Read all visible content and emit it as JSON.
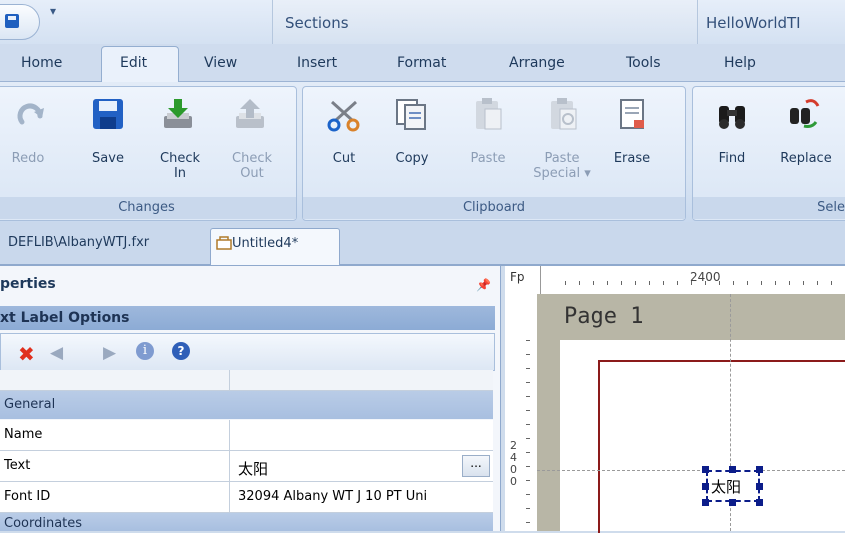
{
  "window": {
    "context_tab_group": "Sections",
    "app_title": "HelloWorldTI"
  },
  "tabs": [
    "Home",
    "Edit",
    "View",
    "Insert",
    "Format",
    "Arrange",
    "Tools",
    "Help"
  ],
  "ribbon": {
    "groups": {
      "changes": "Changes",
      "clipboard": "Clipboard",
      "select": "Sele"
    },
    "buttons": {
      "redo": "Redo",
      "save": "Save",
      "check_in_1": "Check",
      "check_in_2": "In",
      "check_out_1": "Check",
      "check_out_2": "Out",
      "cut": "Cut",
      "copy": "Copy",
      "paste": "Paste",
      "paste_special_1": "Paste",
      "paste_special_2": "Special ▾",
      "erase": "Erase",
      "find": "Find",
      "replace": "Replace"
    }
  },
  "doc_tabs": {
    "tab1": "DEFLIB\\AlbanyWTJ.fxr",
    "tab2": "Untitled4*"
  },
  "properties": {
    "panel_title": "perties",
    "section_title": "xt Label Options",
    "categories": {
      "general": "General",
      "coordinates": "Coordinates"
    },
    "rows": [
      {
        "name": "Name",
        "value": ""
      },
      {
        "name": "Text",
        "value": "太阳"
      },
      {
        "name": "Font ID",
        "value": "32094 Albany WT J 10 PT Uni"
      }
    ],
    "ellipsis": "..."
  },
  "canvas": {
    "ruler_corner": "Fp",
    "ruler_mark": "2400",
    "page_label": "Page 1",
    "ruler_left_digits": "2\n4\n0\n0",
    "label_text": "太阳"
  }
}
